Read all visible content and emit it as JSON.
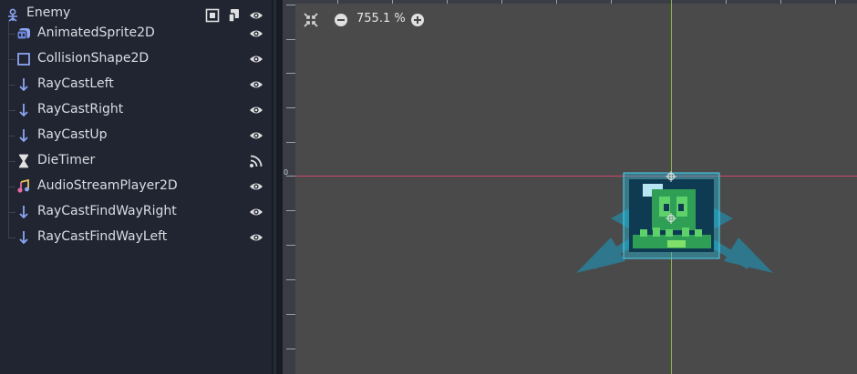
{
  "scene_tree": {
    "root": {
      "label": "Enemy",
      "icon": "node2d-icon"
    },
    "children": [
      {
        "label": "AnimatedSprite2D",
        "icon": "animated-sprite-icon",
        "visibility": "eye-icon"
      },
      {
        "label": "CollisionShape2D",
        "icon": "collision-shape-icon",
        "visibility": "eye-icon"
      },
      {
        "label": "RayCastLeft",
        "icon": "raycast-icon",
        "visibility": "eye-icon"
      },
      {
        "label": "RayCastRight",
        "icon": "raycast-icon",
        "visibility": "eye-icon"
      },
      {
        "label": "RayCastUp",
        "icon": "raycast-icon",
        "visibility": "eye-icon"
      },
      {
        "label": "DieTimer",
        "icon": "timer-icon",
        "visibility": "signal-icon"
      },
      {
        "label": "AudioStreamPlayer2D",
        "icon": "audio-player-icon",
        "visibility": "eye-icon"
      },
      {
        "label": "RayCastFindWayRight",
        "icon": "raycast-icon",
        "visibility": "eye-icon"
      },
      {
        "label": "RayCastFindWayLeft",
        "icon": "raycast-icon",
        "visibility": "eye-icon"
      }
    ]
  },
  "viewport": {
    "zoom": "755.1 %",
    "ruler_origin_label": "0"
  },
  "colors": {
    "panel_bg": "#202531",
    "viewport_bg": "#4a4a4a",
    "x_axis": "#d0466a",
    "y_axis": "#8db24e",
    "raycast_arrow": "#2a7f99",
    "accent_icon": "#8da5f3"
  }
}
